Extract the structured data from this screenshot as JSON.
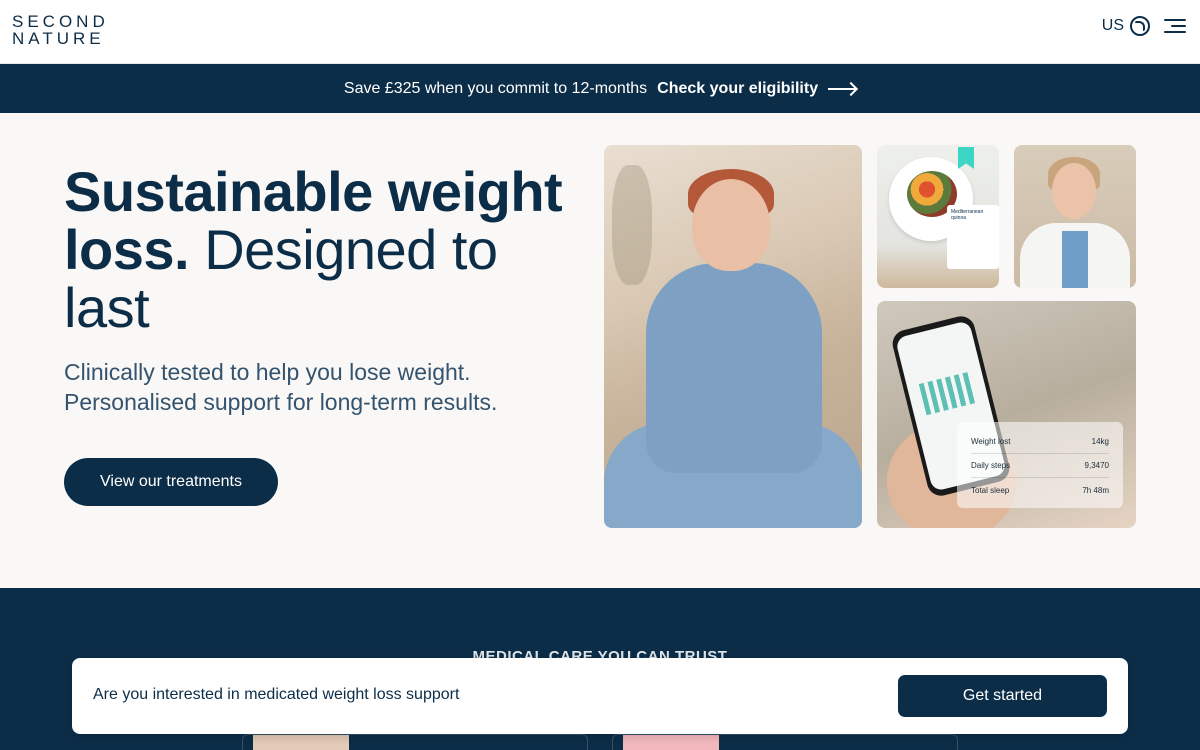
{
  "header": {
    "logo_line1": "SECOND",
    "logo_line2": "NATURE",
    "region": "US"
  },
  "promo": {
    "text": "Save £325 when you commit to 12-months",
    "cta": "Check your eligibility"
  },
  "hero": {
    "title_strong": "Sustainable weight loss.",
    "title_light": "Designed to last",
    "subtitle_line1": "Clinically tested to help you lose weight.",
    "subtitle_line2": "Personalised support for long-term results.",
    "button": "View our treatments"
  },
  "food_card": {
    "title": "Mediterranean quinoa"
  },
  "phone_stats": [
    {
      "label": "Weight lost",
      "value": "14kg"
    },
    {
      "label": "Daily steps",
      "value": "9,3470"
    },
    {
      "label": "Total sleep",
      "value": "7h 48m"
    }
  ],
  "section": {
    "heading": "MEDICAL CARE YOU CAN TRUST"
  },
  "sticky": {
    "text": "Are you interested in medicated weight loss support",
    "button": "Get started"
  },
  "colors": {
    "navy": "#0c2d48",
    "background": "#faf8f6",
    "accent_teal": "#3dd6c6"
  }
}
